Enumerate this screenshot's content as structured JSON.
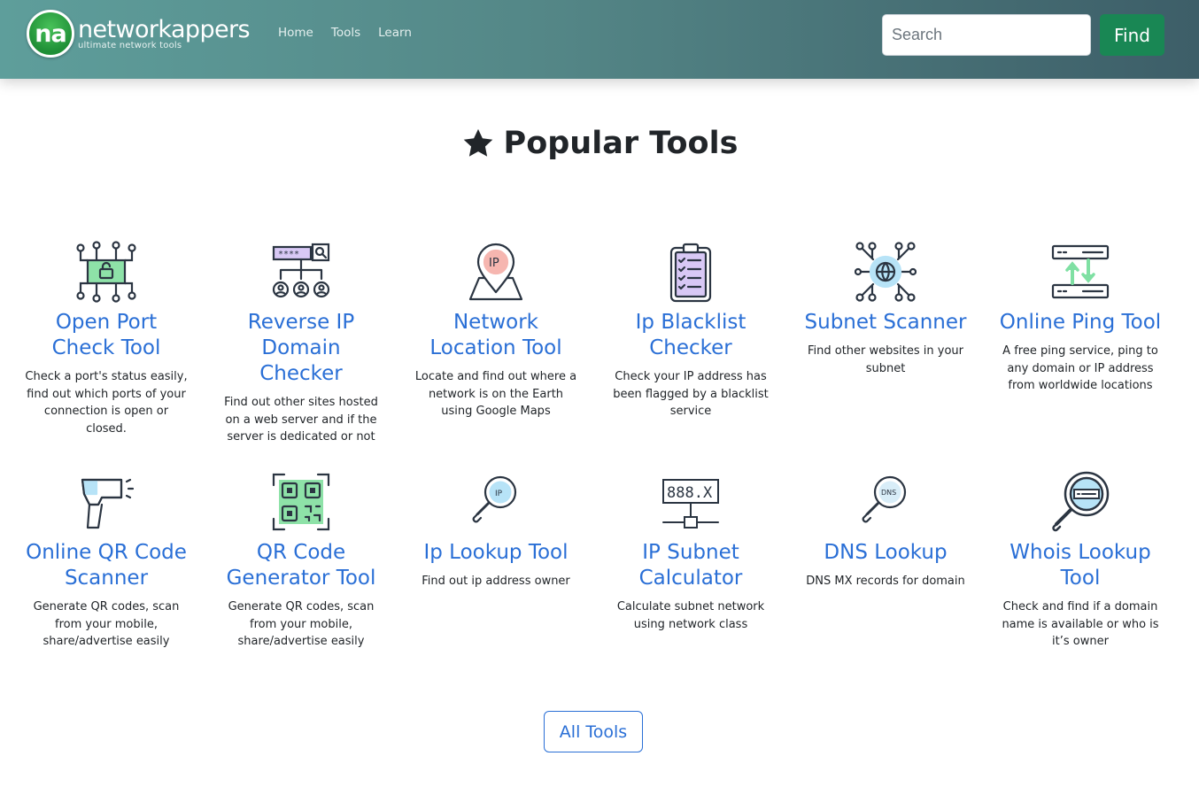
{
  "header": {
    "logo_mark": "na",
    "brand_name": "networkappers",
    "brand_tagline": "ultimate network tools",
    "nav": [
      "Home",
      "Tools",
      "Learn"
    ],
    "search_placeholder": "Search",
    "find_label": "Find"
  },
  "main": {
    "title": "Popular Tools",
    "title_icon": "star-icon",
    "all_tools_label": "All Tools"
  },
  "tools": [
    {
      "title": "Open Port Check Tool",
      "desc": "Check a port's status easily, find out which ports of your connection is open or closed.",
      "icon": "open-port-icon"
    },
    {
      "title": "Reverse IP Domain Checker",
      "desc": "Find out other sites hosted on a web server and if the server is dedicated or not",
      "icon": "reverse-ip-icon"
    },
    {
      "title": "Network Location Tool",
      "desc": "Locate and find out where a network is on the Earth using Google Maps",
      "icon": "location-pin-icon"
    },
    {
      "title": "Ip Blacklist Checker",
      "desc": "Check your IP address has been flagged by a blacklist service",
      "icon": "clipboard-checklist-icon"
    },
    {
      "title": "Subnet Scanner",
      "desc": "Find other websites in your subnet",
      "icon": "network-globe-icon"
    },
    {
      "title": "Online Ping Tool",
      "desc": "A free ping service, ping to any domain or IP address from worldwide locations",
      "icon": "ping-servers-icon"
    },
    {
      "title": "Online QR Code Scanner",
      "desc": "Generate QR codes, scan from your mobile, share/advertise easily",
      "icon": "barcode-scanner-icon"
    },
    {
      "title": "QR Code Generator Tool",
      "desc": "Generate QR codes, scan from your mobile, share/advertise easily",
      "icon": "qr-code-icon"
    },
    {
      "title": "Ip Lookup Tool",
      "desc": "Find out ip address owner",
      "icon": "ip-magnifier-icon"
    },
    {
      "title": "IP Subnet Calculator",
      "desc": "Calculate subnet network using network class",
      "icon": "subnet-calculator-icon",
      "icon_text": "888.X"
    },
    {
      "title": "DNS Lookup",
      "desc": "DNS MX records for domain",
      "icon": "dns-magnifier-icon"
    },
    {
      "title": "Whois Lookup Tool",
      "desc": "Check and find if a domain name is available or who is it’s owner",
      "icon": "whois-magnifier-icon"
    }
  ]
}
